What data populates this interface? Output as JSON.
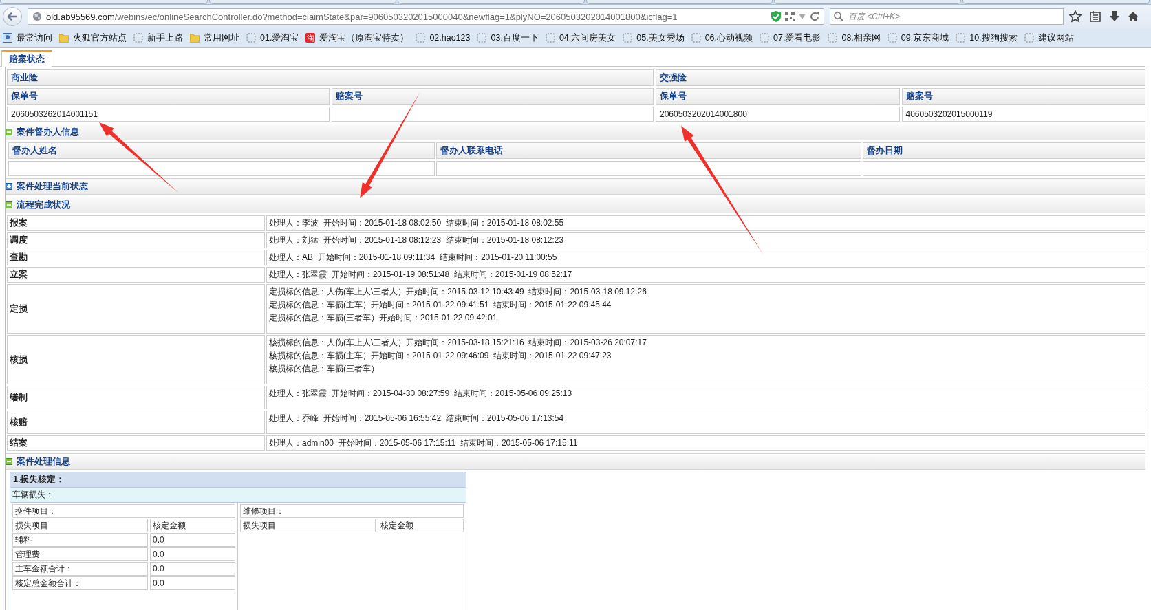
{
  "browser": {
    "url_host": "old.ab95569.com",
    "url_path": "/webins/ec/onlineSearchController.do?method=claimState&par=9060503202015000040&newflag=1&plyNO=2060503202014001800&icflag=1",
    "search_placeholder": "百度 <Ctrl+K>",
    "bookmarks": [
      {
        "label": "最常访问",
        "kind": "recent"
      },
      {
        "label": "火狐官方站点",
        "kind": "folder"
      },
      {
        "label": "新手上路",
        "kind": "page"
      },
      {
        "label": "常用网址",
        "kind": "folder"
      },
      {
        "label": "01.爱淘宝",
        "kind": "page"
      },
      {
        "label": "爱淘宝（原淘宝特卖）",
        "kind": "badge",
        "badge": "淘"
      },
      {
        "label": "02.hao123",
        "kind": "page"
      },
      {
        "label": "03.百度一下",
        "kind": "page"
      },
      {
        "label": "04.六间房美女",
        "kind": "page"
      },
      {
        "label": "05.美女秀场",
        "kind": "page"
      },
      {
        "label": "06.心动视频",
        "kind": "page"
      },
      {
        "label": "07.爱看电影",
        "kind": "page"
      },
      {
        "label": "08.相亲网",
        "kind": "page"
      },
      {
        "label": "09.京东商城",
        "kind": "page"
      },
      {
        "label": "10.搜狗搜索",
        "kind": "page"
      },
      {
        "label": "建议网站",
        "kind": "page"
      }
    ]
  },
  "tabs": [
    {
      "label": "赔案状态",
      "selected": true
    }
  ],
  "policies": [
    {
      "title": "商业险",
      "columns": [
        "保单号",
        "赔案号"
      ],
      "values": [
        "2060503262014001151"
      ]
    },
    {
      "title": "交强险",
      "columns": [
        "保单号",
        "赔案号"
      ],
      "values": [
        "2060503202014001800",
        "4060503202015000119"
      ]
    }
  ],
  "supervisor": {
    "title": "案件督办人信息",
    "expanded": true,
    "columns": [
      "督办人姓名",
      "督办人联系电话",
      "督办日期"
    ]
  },
  "current_state": {
    "title": "案件处理当前状态",
    "expanded": false
  },
  "process": {
    "title": "流程完成状况",
    "expanded": true,
    "rows": [
      {
        "stage": "报案",
        "kind": "line",
        "lines": [
          "处理人：李波  开始时间：2015-01-18 08:02:50  结束时间：2015-01-18 08:02:55"
        ]
      },
      {
        "stage": "调度",
        "kind": "line",
        "lines": [
          "处理人：刘猛  开始时间：2015-01-18 08:12:23  结束时间：2015-01-18 08:12:23"
        ]
      },
      {
        "stage": "查勘",
        "kind": "line",
        "lines": [
          "处理人：AB  开始时间：2015-01-18 09:11:34  结束时间：2015-01-20 11:00:55"
        ]
      },
      {
        "stage": "立案",
        "kind": "line",
        "lines": [
          "处理人：张翠霞  开始时间：2015-01-19 08:51:48  结束时间：2015-01-19 08:52:17"
        ]
      },
      {
        "stage": "定损",
        "kind": "block",
        "lines": [
          "定损标的信息：人伤(车上人\\三者人）开始时间：2015-03-12 10:43:49  结束时间：2015-03-18 09:12:26",
          "定损标的信息：车损(主车）开始时间：2015-01-22 09:41:51  结束时间：2015-01-22 09:45:44",
          "定损标的信息：车损(三者车）开始时间：2015-01-22 09:42:01"
        ]
      },
      {
        "stage": "核损",
        "kind": "block",
        "lines": [
          "核损标的信息：人伤(车上人\\三者人）开始时间：2015-03-18 15:21:16  结束时间：2015-03-26 20:07:17",
          "核损标的信息：车损(主车）开始时间：2015-01-22 09:46:09  结束时间：2015-01-22 09:47:23",
          "核损标的信息：车损(三者车）"
        ]
      },
      {
        "stage": "缮制",
        "kind": "block",
        "lines": [
          "处理人：张翠霞  开始时间：2015-04-30 08:27:59  结束时间：2015-05-06 09:25:13"
        ]
      },
      {
        "stage": "核赔",
        "kind": "block",
        "lines": [
          "处理人：乔峰  开始时间：2015-05-06 16:55:42  结束时间：2015-05-06 17:13:54"
        ]
      },
      {
        "stage": "结案",
        "kind": "line",
        "lines": [
          "处理人：admin00  开始时间：2015-05-06 17:15:11  结束时间：2015-05-06 17:15:11"
        ]
      }
    ]
  },
  "handling": {
    "title": "案件处理信息",
    "expanded": true,
    "heading": "1.损失核定：",
    "subheading": "车辆损失：",
    "parts": {
      "title": "换件项目：",
      "columns": [
        "损失项目",
        "核定金额"
      ],
      "rows": [
        [
          "辅料",
          "0.0"
        ],
        [
          "管理费",
          "0.0"
        ],
        [
          "主车金额合计：",
          "0.0"
        ],
        [
          "核定总金额合计：",
          "0.0"
        ]
      ]
    },
    "repair": {
      "title": "维修项目：",
      "columns": [
        "损失项目",
        "核定金额"
      ]
    }
  }
}
